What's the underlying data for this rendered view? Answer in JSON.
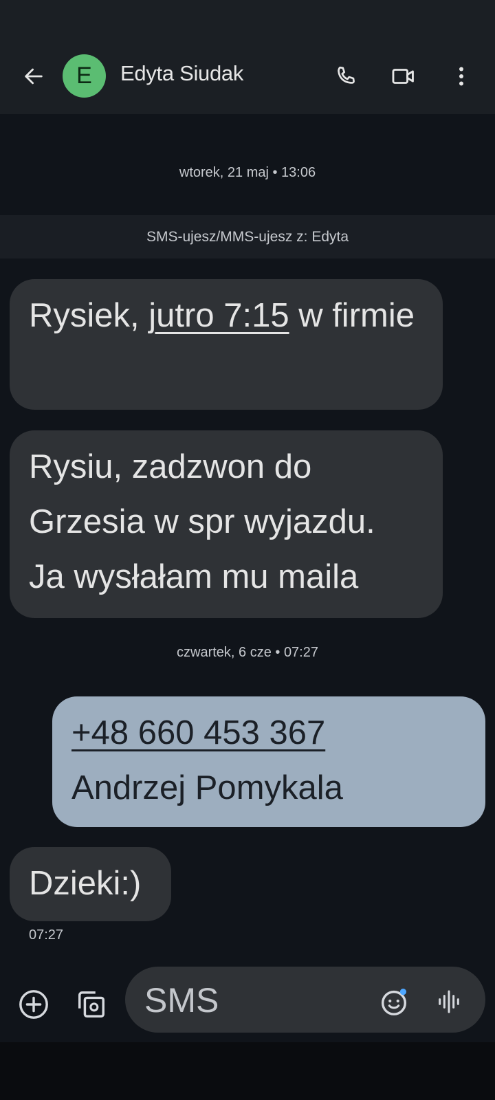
{
  "header": {
    "avatar_letter": "E",
    "contact_name": "Edyta Siudak",
    "avatar_color": "#5bbd72",
    "icons": [
      "back-arrow-icon",
      "phone-icon",
      "video-camera-icon",
      "more-vert-icon"
    ]
  },
  "thread": {
    "date_1": "wtorek, 21 maj • 13:06",
    "sim_banner": "SMS-ujesz/MMS-ujesz z: Edyta",
    "msg_1": {
      "pre": "Rysiek, ",
      "link": "jutro 7:15",
      "post": " w firmie"
    },
    "msg_2": {
      "line_1": "Rysiu, zadzwon do",
      "line_2": "Grzesia w spr  wyjazdu.",
      "line_3": "Ja wysłałam mu maila"
    },
    "date_2": "czwartek, 6 cze • 07:27",
    "msg_3": {
      "phone": "+48 660 453 367",
      "name": "Andrzej Pomykala"
    },
    "msg_4": "Dzieki:)",
    "msg_4_time": "07:27",
    "colors": {
      "incoming": "#2f3236",
      "outgoing": "#9daebf",
      "background": "#10141a"
    }
  },
  "composer": {
    "placeholder": "SMS",
    "icons": [
      "add-circle-icon",
      "gallery-icon",
      "emoji-icon",
      "voice-waveform-icon"
    ]
  }
}
